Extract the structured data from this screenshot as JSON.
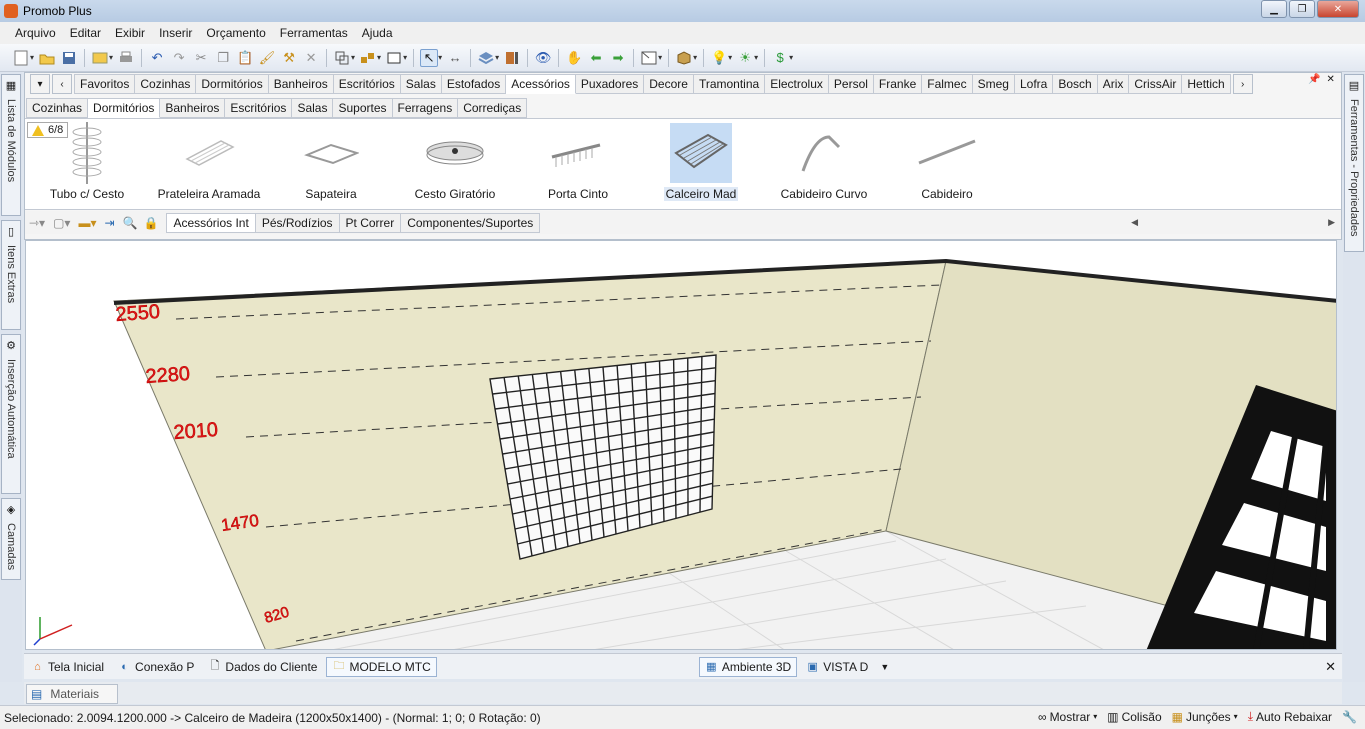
{
  "window": {
    "title": "Promob Plus"
  },
  "menu": [
    "Arquivo",
    "Editar",
    "Exibir",
    "Inserir",
    "Orçamento",
    "Ferramentas",
    "Ajuda"
  ],
  "toolbar_icons": [
    "new-icon",
    "open-icon",
    "save-icon",
    "layout-icon",
    "print-icon",
    "undo-icon",
    "redo-icon",
    "cut-icon",
    "copy-icon",
    "paste-icon",
    "brush-icon",
    "format-icon",
    "delete-icon",
    "group-icon",
    "assemble-icon",
    "shape-icon",
    "select-icon",
    "measure-icon",
    "layers-icon",
    "door-icon",
    "view-icon",
    "camera-icon",
    "back-icon",
    "forward-icon",
    "window-icon",
    "box-icon",
    "light-icon",
    "render-icon",
    "money-icon"
  ],
  "left_dock": [
    "Lista de Módulos",
    "Itens Extras",
    "Inserção Automática",
    "Camadas"
  ],
  "right_dock": [
    "Ferramentas - Propriedades"
  ],
  "categories": [
    "Favoritos",
    "Cozinhas",
    "Dormitórios",
    "Banheiros",
    "Escritórios",
    "Salas",
    "Estofados",
    "Acessórios",
    "Puxadores",
    "Decore",
    "Tramontina",
    "Electrolux",
    "Persol",
    "Franke",
    "Falmec",
    "Smeg",
    "Lofra",
    "Bosch",
    "Arix",
    "CrissAir",
    "Hettich"
  ],
  "active_category": "Acessórios",
  "subcategories": [
    "Cozinhas",
    "Dormitórios",
    "Banheiros",
    "Escritórios",
    "Salas",
    "Suportes",
    "Ferragens",
    "Corrediças"
  ],
  "active_subcategory": "Dormitórios",
  "badge": {
    "text": "6/8"
  },
  "items": [
    {
      "label": "Tubo c/ Cesto"
    },
    {
      "label": "Prateleira Aramada"
    },
    {
      "label": "Sapateira"
    },
    {
      "label": "Cesto Giratório"
    },
    {
      "label": "Porta Cinto"
    },
    {
      "label": "Calceiro Mad",
      "selected": true
    },
    {
      "label": "Cabideiro Curvo"
    },
    {
      "label": "Cabideiro"
    }
  ],
  "section_tabs": [
    "Acessórios Int",
    "Pés/Rodízios",
    "Pt Correr",
    "Componentes/Suportes"
  ],
  "active_section": "Acessórios Int",
  "viewport": {
    "height_marks": [
      "2550",
      "2280",
      "2010",
      "1470",
      "820"
    ]
  },
  "doc_tabs": [
    {
      "label": "Tela Inicial",
      "icon": "home-icon"
    },
    {
      "label": "Conexão P",
      "icon": "connection-icon"
    },
    {
      "label": "Dados do Cliente",
      "icon": "document-icon"
    },
    {
      "label": "MODELO MTC",
      "icon": "folder-icon",
      "active": true
    },
    {
      "label": "Ambiente 3D",
      "icon": "ambient-icon",
      "active": true
    },
    {
      "label": "VISTA D",
      "icon": "view-icon"
    }
  ],
  "materials_tab": "Materiais",
  "status": {
    "text": "Selecionado: 2.0094.1200.000 -> Calceiro de Madeira (1200x50x1400) - (Normal: 1; 0; 0 Rotação: 0)",
    "mostrar": "Mostrar",
    "colisao": "Colisão",
    "juncoes": "Junções",
    "auto_rebaixar": "Auto Rebaixar"
  }
}
